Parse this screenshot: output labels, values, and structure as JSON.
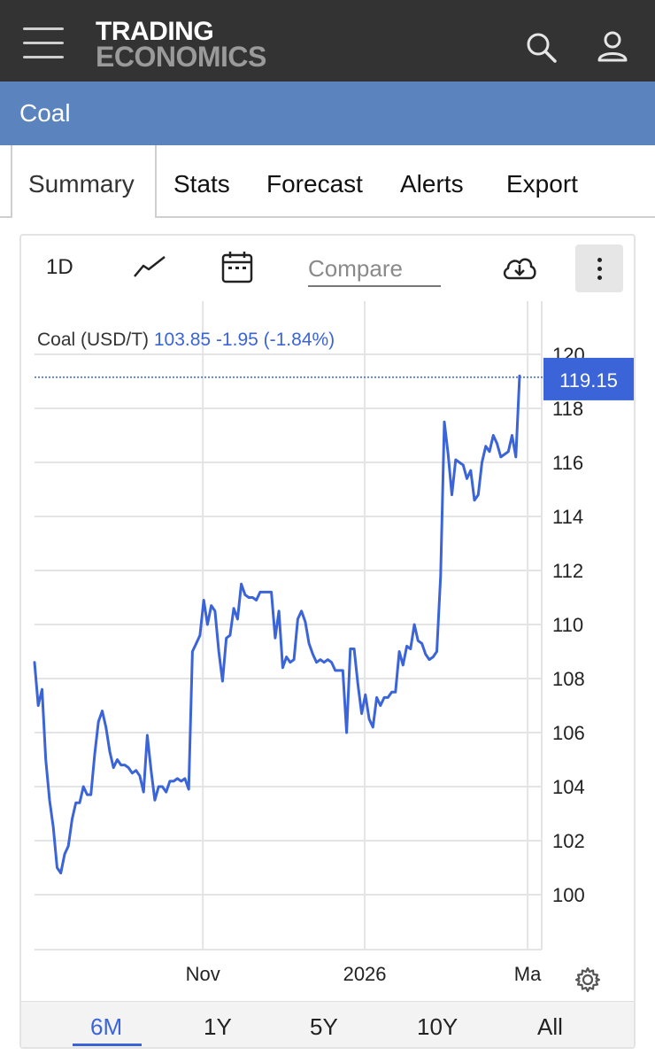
{
  "header": {
    "logo_line1": "TRADING",
    "logo_line2": "ECONOMICS"
  },
  "page": {
    "title": "Coal"
  },
  "tabs": [
    {
      "label": "Summary",
      "active": true
    },
    {
      "label": "Stats"
    },
    {
      "label": "Forecast"
    },
    {
      "label": "Alerts"
    },
    {
      "label": "Export"
    }
  ],
  "toolbar": {
    "interval_label": "1D",
    "compare_placeholder": "Compare"
  },
  "legend": {
    "name": "Coal (USD/T)",
    "value": "103.85",
    "change": "-1.95 (-1.84%)"
  },
  "last_value_label": "119.15",
  "ranges": [
    {
      "label": "6M",
      "active": true
    },
    {
      "label": "1Y"
    },
    {
      "label": "5Y"
    },
    {
      "label": "10Y"
    },
    {
      "label": "All"
    }
  ],
  "colors": {
    "header_bg": "#333333",
    "title_band": "#5b83bd",
    "series": "#3b64d8"
  },
  "chart_data": {
    "type": "line",
    "ylim": [
      98.5,
      121
    ],
    "y_ticks": [
      100,
      102,
      104,
      106,
      108,
      110,
      112,
      114,
      116,
      118,
      120
    ],
    "x_ticks": [
      {
        "label": "Nov",
        "t": 0.339
      },
      {
        "label": "2026",
        "t": 0.665
      },
      {
        "label": "Ma",
        "t": 0.993
      }
    ],
    "last_value": 119.15,
    "series": [
      {
        "values": [
          108.6,
          107.0,
          107.6,
          105.0,
          103.5,
          102.5,
          101.0,
          100.8,
          101.5,
          101.8,
          102.8,
          103.4,
          103.4,
          104.0,
          103.7,
          103.7,
          105.2,
          106.4,
          106.8,
          106.2,
          105.3,
          104.7,
          105.0,
          104.8,
          104.8,
          104.7,
          104.5,
          104.6,
          104.4,
          103.8,
          105.9,
          104.6,
          103.5,
          104.0,
          104.0,
          103.8,
          104.2,
          104.2,
          104.3,
          104.2,
          104.3,
          103.9,
          109.0,
          109.3,
          109.6,
          110.9,
          110.0,
          110.7,
          110.5,
          109.0,
          107.9,
          109.5,
          109.6,
          110.6,
          110.2,
          111.5,
          111.1,
          111.0,
          111.0,
          110.9,
          111.2,
          111.2,
          111.2,
          111.2,
          109.5,
          110.5,
          108.4,
          108.8,
          108.6,
          108.7,
          110.2,
          110.5,
          110.1,
          109.3,
          108.9,
          108.6,
          108.7,
          108.6,
          108.7,
          108.6,
          108.3,
          108.3,
          108.3,
          106.0,
          109.1,
          109.1,
          107.8,
          106.7,
          107.4,
          106.5,
          106.2,
          107.3,
          107.0,
          107.3,
          107.3,
          107.5,
          107.5,
          109.0,
          108.5,
          109.2,
          109.1,
          110.0,
          109.4,
          109.3,
          108.9,
          108.7,
          108.8,
          109.0,
          111.8,
          117.5,
          116.3,
          114.8,
          116.1,
          116.0,
          115.9,
          115.4,
          115.7,
          114.6,
          114.8,
          116.0,
          116.6,
          116.4,
          117.0,
          116.7,
          116.2,
          116.3,
          116.4,
          117.0,
          116.2,
          119.2
        ]
      }
    ]
  }
}
